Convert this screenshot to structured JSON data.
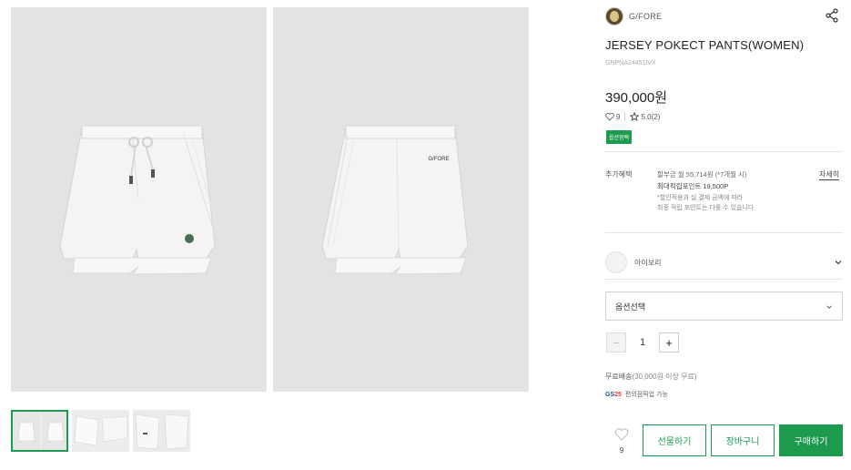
{
  "brand": {
    "name": "G/FORE"
  },
  "product": {
    "title": "JERSEY POKECT PANTS(WOMEN)",
    "code": "GNPNA24451IVX",
    "price": "390,000원",
    "likes": "9",
    "rating": "5.0(2)",
    "badge": "옵션정택",
    "garment_logo_text": "G/FORE"
  },
  "benefits": {
    "label": "추가혜택",
    "installment": "할부금 월 55,714원 (*7개월 시)",
    "points": "최대적립포인트 19,500P",
    "note_line1": "*할인적용과 실 결제 금액에 따라",
    "note_line2": "최종 적립 포인트는 다를 수 있습니다",
    "detail_link": "자세히"
  },
  "color": {
    "name": "아이보리",
    "swatch": "#f3f3f3"
  },
  "option_select": {
    "label": "옵션선택"
  },
  "quantity": {
    "minus": "−",
    "value": "1",
    "plus": "+"
  },
  "shipping": {
    "main": "무료배송",
    "sub": "(30,000원 이상 무료)",
    "gs_logo_prefix": "GS",
    "gs_logo_num": "25",
    "gs_text": "편의점픽업 가능"
  },
  "actions": {
    "wish_count": "9",
    "gift": "선물하기",
    "cart": "장바구니",
    "buy": "구매하기"
  },
  "colors": {
    "accent": "#1c9a4e",
    "image_bg": "#e3e3e3"
  },
  "icons": [
    "share-icon",
    "heart-icon",
    "star-icon",
    "chevron-down-icon"
  ]
}
